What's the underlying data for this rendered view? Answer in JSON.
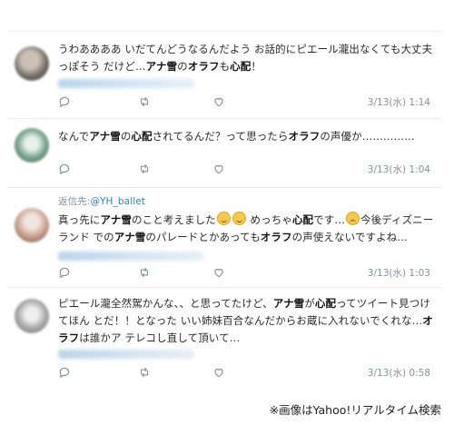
{
  "tweets": [
    {
      "reply_to": null,
      "segments": [
        {
          "t": "うわああああ いだてんどうなるんだよう お話的にピエール瀧出なくても大丈夫っぽそう だけど…"
        },
        {
          "t": "アナ雪",
          "b": true
        },
        {
          "t": "の"
        },
        {
          "t": "オラフ",
          "b": true
        },
        {
          "t": "も"
        },
        {
          "t": "心配",
          "b": true
        },
        {
          "t": "！"
        }
      ],
      "date": "3/13(水) 1:14"
    },
    {
      "reply_to": null,
      "segments": [
        {
          "t": "なんで"
        },
        {
          "t": "アナ雪",
          "b": true
        },
        {
          "t": "の"
        },
        {
          "t": "心配",
          "b": true
        },
        {
          "t": "されてるんだ？って思ったら"
        },
        {
          "t": "オラフ",
          "b": true
        },
        {
          "t": "の声優か……………"
        }
      ],
      "date": "3/13(水) 1:04"
    },
    {
      "reply_to": {
        "prefix": "返信先:",
        "handle": "@YH_ballet"
      },
      "segments": [
        {
          "t": "真っ先に"
        },
        {
          "t": "アナ雪",
          "b": true
        },
        {
          "t": "のこと考えました"
        },
        {
          "emoji": "grin"
        },
        {
          "emoji": "grin"
        },
        {
          "t": " めっちゃ"
        },
        {
          "t": "心配",
          "b": true
        },
        {
          "t": "です…"
        },
        {
          "emoji": "sad"
        },
        {
          "t": "今後ディズニーランド での"
        },
        {
          "t": "アナ雪",
          "b": true
        },
        {
          "t": "のパレードとかあっても"
        },
        {
          "t": "オラフ",
          "b": true
        },
        {
          "t": "の声使えないですよね…"
        }
      ],
      "date": "3/13(水) 1:03"
    },
    {
      "reply_to": null,
      "segments": [
        {
          "t": "ピエール瀧全然駕かんな、、と思ってたけど、"
        },
        {
          "t": "アナ雪",
          "b": true
        },
        {
          "t": "が"
        },
        {
          "t": "心配",
          "b": true
        },
        {
          "t": "ってツイート見つけてほん とだ！！となった いい姉妹百合なんだからお蔵に入れないでくれな…"
        },
        {
          "t": "オラフ",
          "b": true
        },
        {
          "t": "は誰かア テレコし直して頂いて…"
        }
      ],
      "date": "3/13(水) 0:58"
    }
  ],
  "icons": {
    "reply": "reply-icon",
    "retweet": "retweet-icon",
    "like": "heart-icon"
  },
  "caption": "※画像はYahoo!リアルタイム検索"
}
